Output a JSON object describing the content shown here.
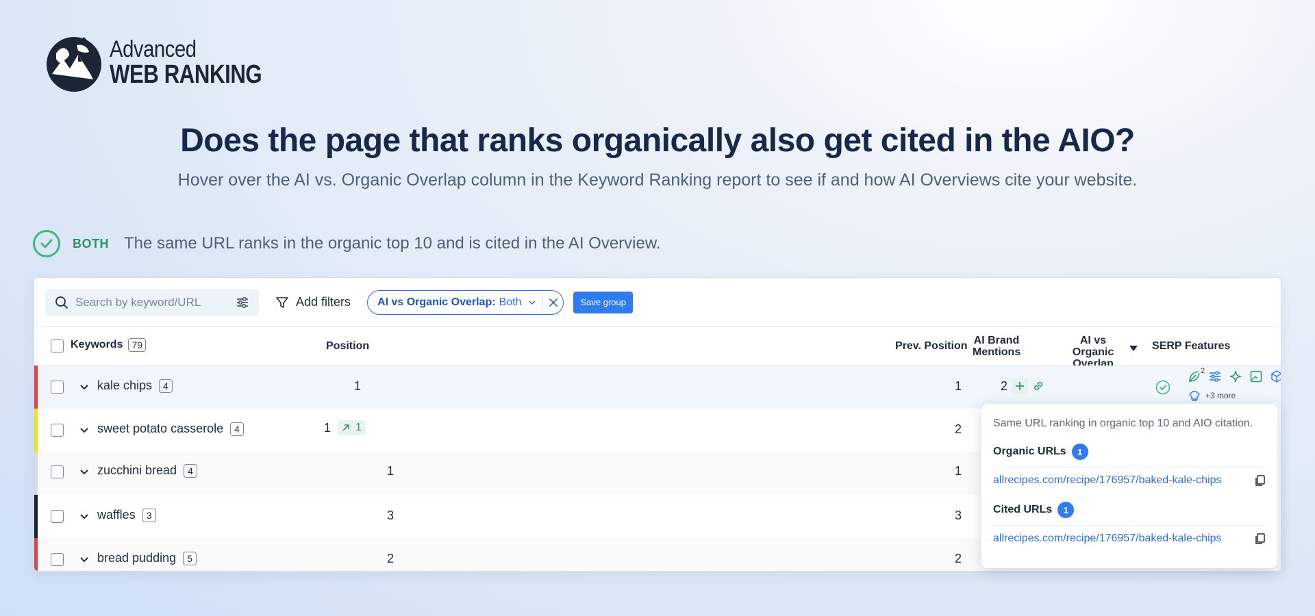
{
  "brand": {
    "line1": "Advanced",
    "line2": "WEB RANKING"
  },
  "hero": {
    "title": "Does the page that ranks organically also get cited in the AIO?",
    "subtitle": "Hover over the AI vs. Organic Overlap column in the Keyword Ranking report to see if and how AI Overviews cite your website."
  },
  "legend": {
    "tag": "BOTH",
    "description": "The same URL ranks in the organic top 10 and is cited in the AI Overview.",
    "color": "#3bb87c"
  },
  "toolbar": {
    "search_placeholder": "Search by keyword/URL",
    "add_filters": "Add filters",
    "filter_chip_key": "AI vs Organic Overlap:",
    "filter_chip_value": "Both",
    "save_group": "Save group"
  },
  "table": {
    "headers": {
      "keywords": "Keywords",
      "keywords_count": "79",
      "position": "Position",
      "prev_position": "Prev. Position",
      "ai_brand_mentions_1": "AI Brand",
      "ai_brand_mentions_2": "Mentions",
      "overlap_1": "AI vs Organic",
      "overlap_2": "Overlap",
      "serp_features": "SERP Features"
    },
    "rows": [
      {
        "keyword": "kale chips",
        "count": "4",
        "position": "1",
        "change": "",
        "prev": "1",
        "mentions": "2",
        "stripe": "#d8474a"
      },
      {
        "keyword": "sweet potato casserole",
        "count": "4",
        "position": "1",
        "change": "1",
        "prev": "2",
        "mentions": "",
        "stripe": "#e9e23a"
      },
      {
        "keyword": "zucchini bread",
        "count": "4",
        "position": "1",
        "change": "",
        "prev": "1",
        "mentions": "",
        "stripe": "#d7dae2"
      },
      {
        "keyword": "waffles",
        "count": "3",
        "position": "3",
        "change": "",
        "prev": "3",
        "mentions": "",
        "stripe": "#1b2233"
      },
      {
        "keyword": "bread pudding",
        "count": "5",
        "position": "2",
        "change": "",
        "prev": "2",
        "mentions": "",
        "stripe": "#d8474a"
      }
    ],
    "serp_more": "+3 more",
    "serp_badge_count": "2"
  },
  "popup": {
    "description": "Same URL ranking in organic top 10 and AIO citation.",
    "organic_label": "Organic URLs",
    "organic_count": "1",
    "organic_url": "allrecipes.com/recipe/176957/baked-kale-chips",
    "cited_label": "Cited URLs",
    "cited_count": "1",
    "cited_url": "allrecipes.com/recipe/176957/baked-kale-chips"
  },
  "colors": {
    "accent": "#2f7cf0",
    "heading": "#17284a",
    "success": "#3bb87c"
  }
}
